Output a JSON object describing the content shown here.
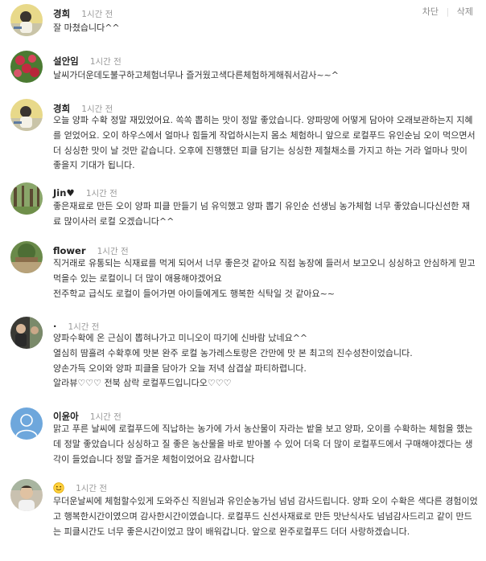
{
  "actions": {
    "block": "차단",
    "delete": "삭제"
  },
  "comments": [
    {
      "author": "경희",
      "time": "1시간 전",
      "lines": [
        "잘 마쳤습니다^^"
      ]
    },
    {
      "author": "설안임",
      "time": "1시간 전",
      "lines": [
        "날씨가더운데도불구하고체험너무나 즐거웠고색다른체험하게해줘서감사~~^"
      ]
    },
    {
      "author": "경희",
      "time": "1시간 전",
      "lines": [
        "오늘 양파 수확 정말 재밌었어요. 쏙쏙 뽑히는 맛이 정말 좋았습니다. 양파망에 어떻게 담아야 오래보관하는지 지혜를 얻었어요. 오이 하우스에서 얼마나 힘들게 작업하시는지 몸소 체험하니 앞으로 로컬푸드 유인순님 오이 먹으면서 더 싱싱한 맛이 날 것만 같습니다. 오후에 진행했던 피클 담기는 싱싱한 제철채소를 가지고 하는 거라 얼마나 맛이 좋을지 기대가 됩니다."
      ]
    },
    {
      "author": "Jin♥",
      "time": "1시간 전",
      "lines": [
        "좋은재료로 만든 오이 양파 피클 만들기 넘 유익했고 양파 뽑기 유인순 선생님 농가체험 너무 좋았습니다신선한 재료 많이사러 로컬 오겠습니다^^"
      ]
    },
    {
      "author": "flower",
      "time": "1시간 전",
      "lines": [
        "직거래로 유통되는 식재료를 먹게 되어서 너무 좋은것 같아요 직접 농장에 들러서 보고오니 싱싱하고 안심하게 믿고 먹을수 있는 로컬이니 더 많이 애용해야겠어요",
        "전주학교 급식도 로컬이 들어가면 아이들에게도 행복한 식탁일 것 같아요~~"
      ]
    },
    {
      "author": "·",
      "time": "1시간 전",
      "lines": [
        "양파수확에 온 근심이 뽑혀나가고 미니오이 따기에 신바람 났네요^^",
        "열심히 땀흘려 수확후에 맛본 완주 로컬 농가레스토랑은 간만에 맛 본 최고의 진수성찬이었습니다.",
        "양손가득 오이와 양파 피클을 담아가 오늘 저녁 삼겹살 파티하렵니다.",
        "알라뷰♡♡♡ 전북 삼락 로컬푸드입니다오♡♡♡"
      ]
    },
    {
      "author": "이윤아",
      "time": "1시간 전",
      "lines": [
        "맑고 푸른 날씨에 로컬푸드에 직납하는 농가에 가서 농산물이 자라는 밭을 보고 양파, 오이를 수확하는 체험을 했는데 정말 좋았습니다 싱싱하고 질 좋은 농산물을 바로 받아볼 수 있어 더욱 더 많이 로컬푸드에서 구매해야겠다는 생각이 들었습니다 정말 즐거운 체험이었어요 감사합니다"
      ]
    },
    {
      "author": "",
      "time": "1시간 전",
      "lines": [
        "무더운날씨에 체험할수있게 도와주신 직원님과 유인순농가님 넘넘 감사드립니다. 양파 오이 수확은 색다른 경험이었고 행복한시간이였으며 감사한시간이였습니다. 로컬푸드 신선사재료로 만든 맛난식사도 넘넘감사드리고 같이 만드는 피클시간도 너무 좋은시간이었고 많이 배워갑니다. 앞으로 완주로컬푸드 더더 사랑하겠습니다."
      ]
    }
  ]
}
